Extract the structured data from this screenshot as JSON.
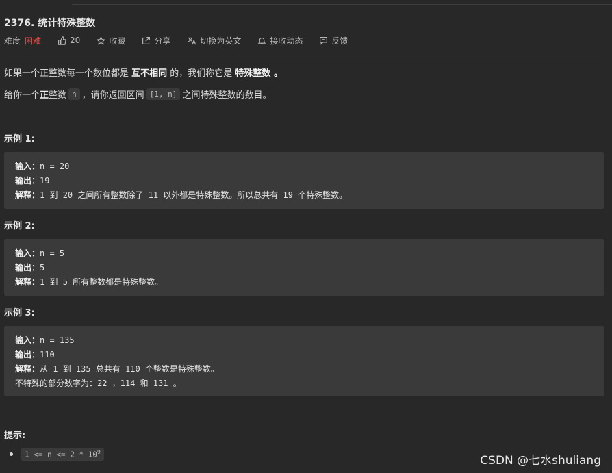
{
  "problem": {
    "title": "2376. 统计特殊整数",
    "meta": {
      "difficulty_label": "难度",
      "difficulty": "困难",
      "likes": "20",
      "favorite": "收藏",
      "share": "分享",
      "switch_lang": "切换为英文",
      "feed": "接收动态",
      "feedback": "反馈"
    },
    "desc1": {
      "a": "如果一个正整数每一个数位都是 ",
      "b": "互不相同",
      "c": " 的，我们称它是 ",
      "d": "特殊整数",
      "e": " 。"
    },
    "desc2": {
      "a": "给你一个 ",
      "b": "正",
      "c": " 整数 ",
      "code1": "n",
      "d": "，请你返回区间 ",
      "code2": "[1, n]",
      "e": " 之间特殊整数的数目。"
    },
    "examples": [
      {
        "heading": "示例 1:",
        "input_label": "输入：",
        "input": "n = 20",
        "output_label": "输出：",
        "output": "19",
        "explain_label": "解释：",
        "explain": "1 到 20 之间所有整数除了 11 以外都是特殊整数。所以总共有 19 个特殊整数。"
      },
      {
        "heading": "示例 2:",
        "input_label": "输入：",
        "input": "n = 5",
        "output_label": "输出：",
        "output": "5",
        "explain_label": "解释：",
        "explain": "1 到 5 所有整数都是特殊整数。"
      },
      {
        "heading": "示例 3:",
        "input_label": "输入：",
        "input": "n = 135",
        "output_label": "输出：",
        "output": "110",
        "explain_label": "解释：",
        "explain": "从 1 到 135 总共有 110 个整数是特殊整数。",
        "extra": "不特殊的部分数字为：22 ，114 和 131 。"
      }
    ],
    "hints": {
      "heading": "提示:",
      "constraint_base": "1 <= n <= 2 * 10",
      "constraint_exp": "9"
    }
  },
  "watermark": "CSDN @七水shuliang",
  "colors": {
    "difficulty_hard": "#ef4743",
    "background": "#282828",
    "code_block": "#3a3a3a"
  }
}
